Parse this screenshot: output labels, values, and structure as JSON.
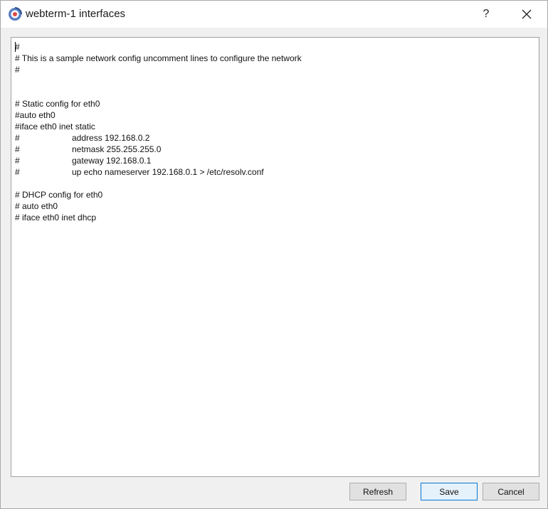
{
  "window": {
    "title": "webterm-1 interfaces",
    "help_label": "?"
  },
  "editor": {
    "lines": [
      [
        "#",
        ""
      ],
      [
        "# This is a sample network config uncomment lines to configure the network",
        ""
      ],
      [
        "#",
        ""
      ],
      [
        "",
        ""
      ],
      [
        "",
        ""
      ],
      [
        "# Static config for eth0",
        ""
      ],
      [
        "#auto eth0",
        ""
      ],
      [
        "#iface eth0 inet static",
        ""
      ],
      [
        "#",
        "address 192.168.0.2"
      ],
      [
        "#",
        "netmask 255.255.255.0"
      ],
      [
        "#",
        "gateway 192.168.0.1"
      ],
      [
        "#",
        "up echo nameserver 192.168.0.1 > /etc/resolv.conf"
      ],
      [
        "",
        ""
      ],
      [
        "# DHCP config for eth0",
        ""
      ],
      [
        "# auto eth0",
        ""
      ],
      [
        "# iface eth0 inet dhcp",
        ""
      ]
    ]
  },
  "buttons": {
    "refresh": "Refresh",
    "save": "Save",
    "cancel": "Cancel"
  }
}
